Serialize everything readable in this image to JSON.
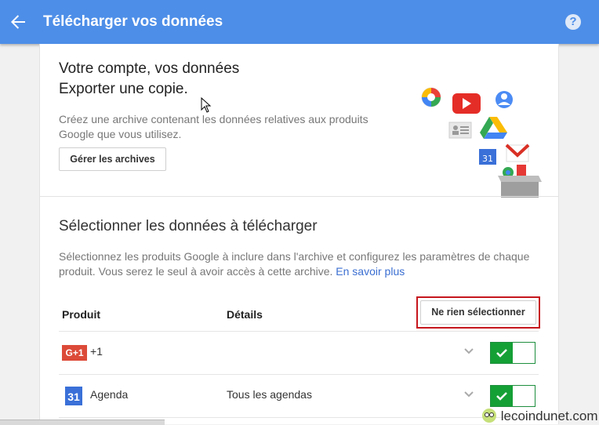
{
  "topbar": {
    "title": "Télécharger vos données",
    "back_icon": "arrow-back-icon",
    "help_icon": "help-icon",
    "help_glyph": "?",
    "color": "#4d8ee8"
  },
  "export": {
    "heading_line1": "Votre compte, vos données",
    "heading_line2": "Exporter une copie.",
    "desc_line1": "Créez une archive contenant les données relatives aux produits",
    "desc_line2": "Google que vous utilisez.",
    "manage_button": "Gérer les archives"
  },
  "select": {
    "title": "Sélectionner les données à télécharger",
    "desc_line1": "Sélectionnez les produits Google à inclure dans l'archive et configurez les paramètres de chaque",
    "desc_line2": "produit. Vous serez le seul à avoir accès à cette archive.",
    "learn_more": "En savoir plus"
  },
  "table": {
    "col_product": "Produit",
    "col_details": "Détails",
    "deselect_button": "Ne rien sélectionner",
    "rows": [
      {
        "product": "+1",
        "icon": "google-plus-one-icon",
        "icon_text": "G+1",
        "details": "",
        "enabled": true
      },
      {
        "product": "Agenda",
        "icon": "calendar-icon",
        "icon_text": "31",
        "details": "Tous les agendas",
        "enabled": true
      }
    ]
  },
  "watermark": "lecoindunet.com"
}
